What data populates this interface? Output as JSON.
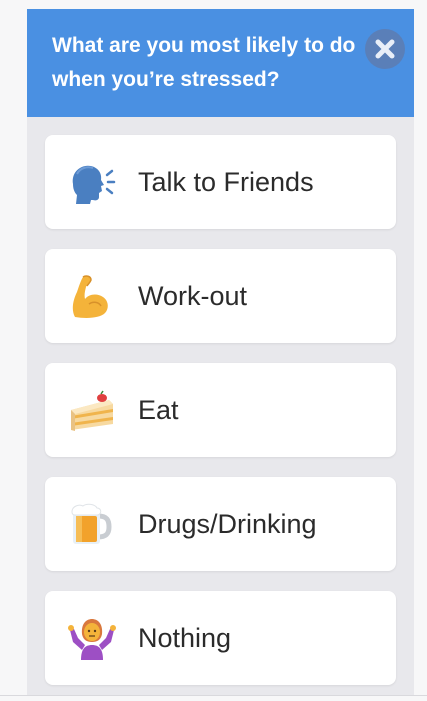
{
  "question": {
    "text": "What are you most likely to do when you’re stressed?"
  },
  "close_button": {
    "icon": "close-icon"
  },
  "options": [
    {
      "label": "Talk to Friends",
      "icon": "speaking-head-icon"
    },
    {
      "label": "Work-out",
      "icon": "flexed-biceps-icon"
    },
    {
      "label": "Eat",
      "icon": "cake-slice-icon"
    },
    {
      "label": "Drugs/Drinking",
      "icon": "beer-mug-icon"
    },
    {
      "label": "Nothing",
      "icon": "person-shrugging-icon"
    }
  ],
  "colors": {
    "header_background": "#4a90e2",
    "panel_background": "#e8e8ec",
    "card_background": "#ffffff",
    "close_button": "#5a7fb8",
    "label_text": "#2b2b2b"
  }
}
